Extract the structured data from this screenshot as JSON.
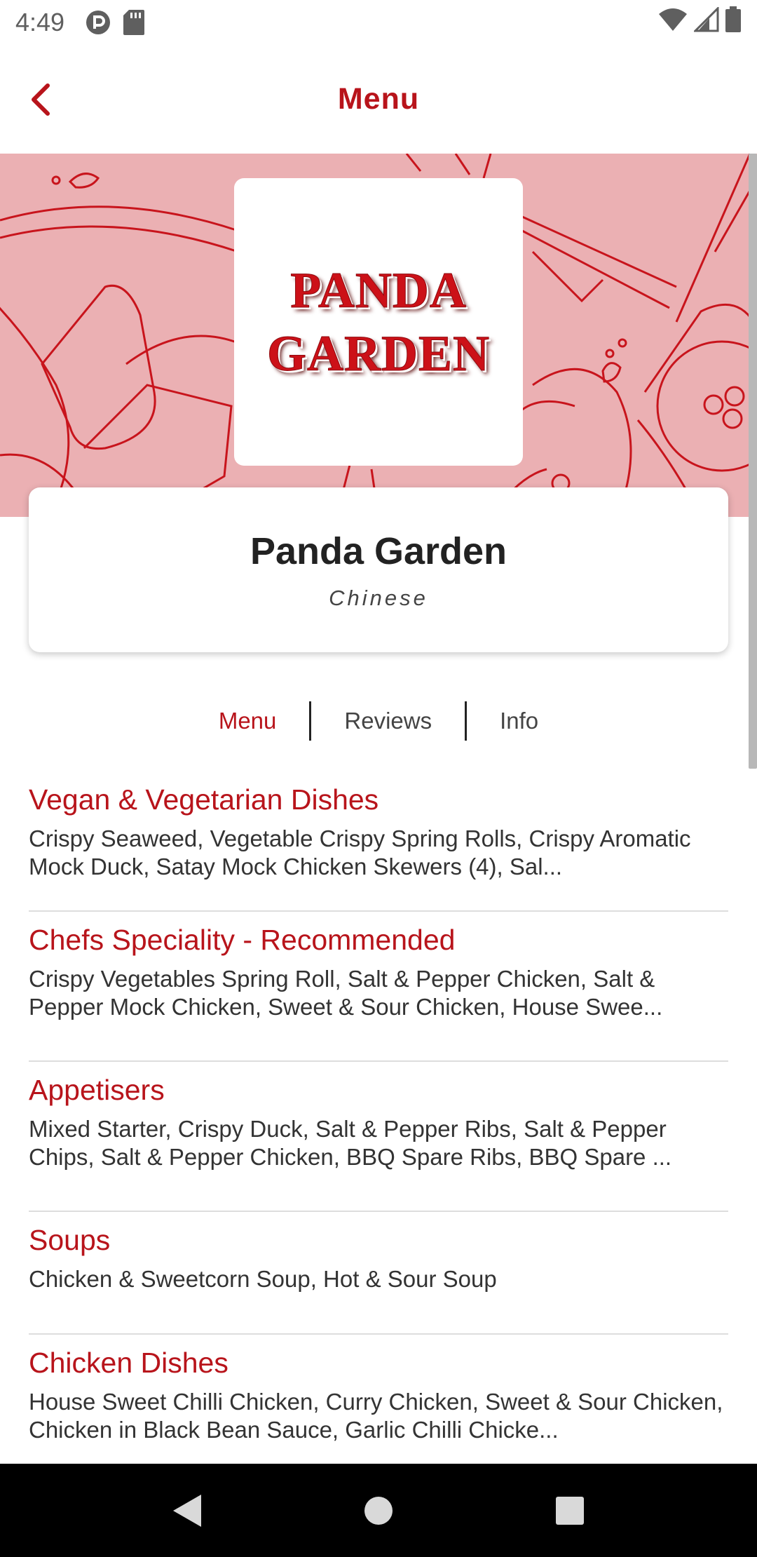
{
  "status_bar": {
    "time": "4:49",
    "left_icons": [
      "notification-icon",
      "sd-card-icon"
    ],
    "right_icons": [
      "wifi-icon",
      "signal-icon",
      "battery-icon"
    ]
  },
  "app_bar": {
    "title": "Menu",
    "back_icon": "chevron-left-icon"
  },
  "colors": {
    "brand_red": "#b8141b",
    "hero_pink": "#ebb0b3",
    "text_dark": "#222222"
  },
  "hero": {
    "logo_lines": [
      "PANDA",
      "GARDEN"
    ]
  },
  "restaurant": {
    "name": "Panda Garden",
    "cuisine": "Chinese"
  },
  "tabs": [
    {
      "label": "Menu",
      "active": true
    },
    {
      "label": "Reviews",
      "active": false
    },
    {
      "label": "Info",
      "active": false
    }
  ],
  "menu_sections": [
    {
      "title": "Vegan & Vegetarian Dishes",
      "items": "Crispy Seaweed, Vegetable Crispy Spring Rolls, Crispy Aromatic Mock Duck, Satay Mock Chicken Skewers (4), Sal..."
    },
    {
      "title": "Chefs Speciality - Recommended",
      "items": "Crispy Vegetables Spring Roll, Salt & Pepper Chicken, Salt & Pepper Mock Chicken, Sweet & Sour Chicken, House Swee..."
    },
    {
      "title": "Appetisers",
      "items": "Mixed Starter, Crispy Duck, Salt & Pepper Ribs, Salt & Pepper Chips, Salt & Pepper Chicken, BBQ Spare Ribs, BBQ Spare ..."
    },
    {
      "title": "Soups",
      "items": "Chicken & Sweetcorn Soup, Hot & Sour Soup"
    },
    {
      "title": "Chicken Dishes",
      "items": "House Sweet Chilli Chicken, Curry Chicken, Sweet & Sour Chicken, Chicken in Black Bean Sauce, Garlic Chilli Chicke..."
    }
  ],
  "nav_bar": {
    "buttons": [
      "back-triangle-icon",
      "home-circle-icon",
      "recents-square-icon"
    ]
  }
}
